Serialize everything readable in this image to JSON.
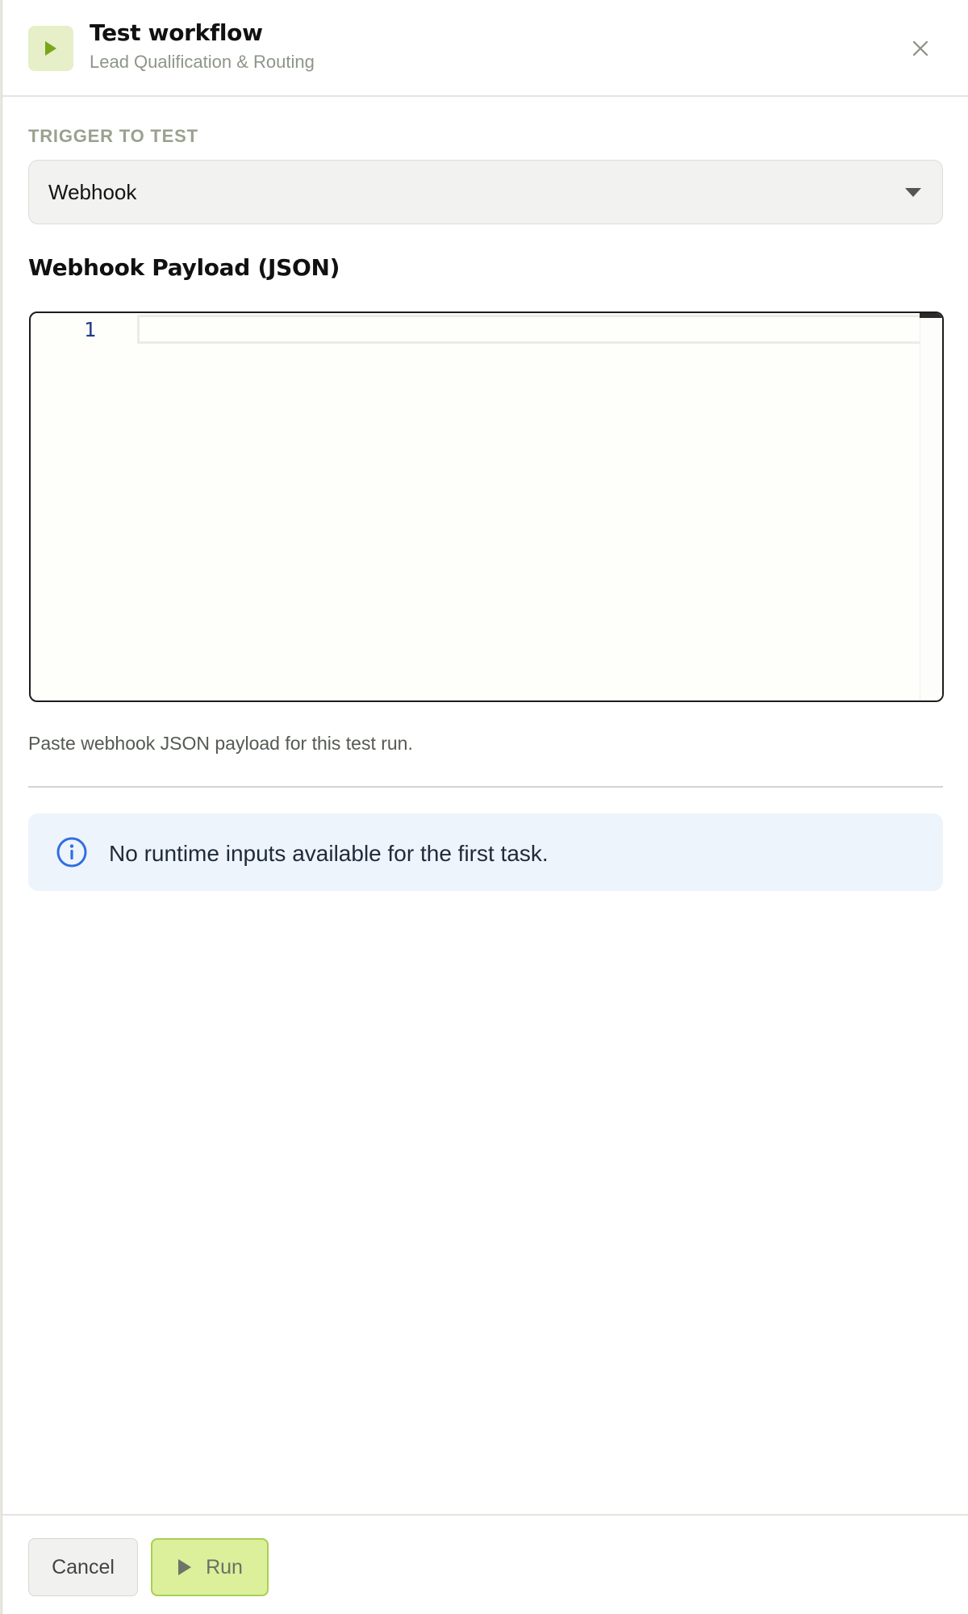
{
  "header": {
    "title": "Test workflow",
    "subtitle": "Lead Qualification & Routing",
    "icon": "play-icon",
    "close_icon": "close-icon"
  },
  "trigger": {
    "label": "TRIGGER TO TEST",
    "selected": "Webhook"
  },
  "payload": {
    "title": "Webhook Payload (JSON)",
    "line_numbers": [
      "1"
    ],
    "value": "",
    "help_text": "Paste webhook JSON payload for this test run."
  },
  "info": {
    "icon": "info-icon",
    "message": "No runtime inputs available for the first task."
  },
  "footer": {
    "cancel_label": "Cancel",
    "run_label": "Run",
    "run_icon": "play-icon"
  },
  "colors": {
    "accent": "#dcef9a",
    "accent_border": "#a9cf54",
    "play_icon": "#7aa51a",
    "info_blue": "#2f6fe0",
    "info_bg": "#eef4fb"
  }
}
